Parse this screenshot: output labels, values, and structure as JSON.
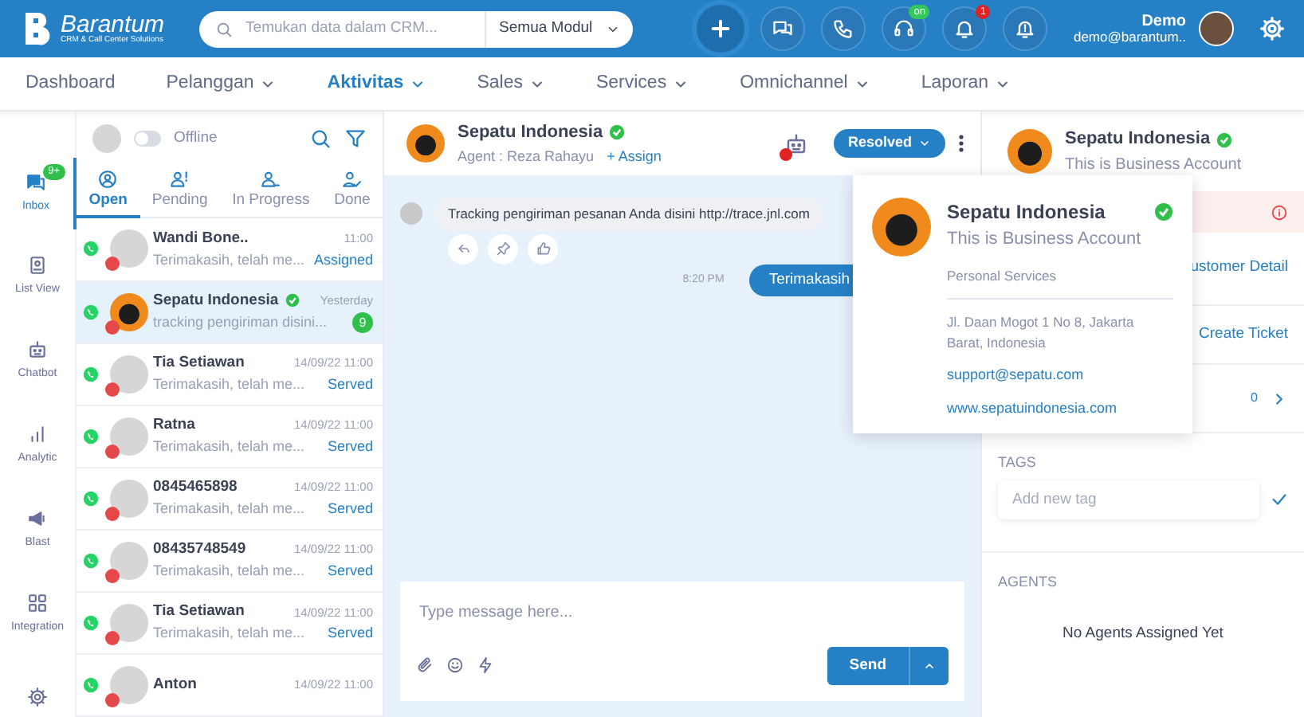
{
  "header": {
    "logo": {
      "name": "Barantum",
      "tagline": "CRM & Call Center Solutions"
    },
    "search": {
      "placeholder": "Temukan data dalam CRM...",
      "module": "Semua Modul"
    },
    "actions": [
      {
        "kind": "add"
      },
      {
        "kind": "chat"
      },
      {
        "kind": "phone"
      },
      {
        "kind": "headset",
        "badge": "on",
        "color": "#35c759"
      },
      {
        "kind": "bell",
        "badge": "1",
        "color": "#e02424"
      },
      {
        "kind": "alert"
      }
    ],
    "user": {
      "name": "Demo",
      "email": "demo@barantum.."
    }
  },
  "nav": [
    {
      "label": "Dashboard",
      "dropdown": false,
      "selected": false
    },
    {
      "label": "Pelanggan",
      "dropdown": true,
      "selected": false
    },
    {
      "label": "Aktivitas",
      "dropdown": true,
      "selected": true
    },
    {
      "label": "Sales",
      "dropdown": true,
      "selected": false
    },
    {
      "label": "Services",
      "dropdown": true,
      "selected": false
    },
    {
      "label": "Omnichannel",
      "dropdown": true,
      "selected": false
    },
    {
      "label": "Laporan",
      "dropdown": true,
      "selected": false
    }
  ],
  "sidebar": {
    "items": [
      {
        "kind": "inbox",
        "label": "Inbox",
        "badge": "9+",
        "selected": true
      },
      {
        "kind": "list",
        "label": "List View",
        "selected": false
      },
      {
        "kind": "bot",
        "label": "Chatbot",
        "selected": false
      },
      {
        "kind": "chart",
        "label": "Analytic",
        "selected": false
      },
      {
        "kind": "blast",
        "label": "Blast",
        "selected": false
      },
      {
        "kind": "grid",
        "label": "Integration",
        "selected": false
      },
      {
        "kind": "gear",
        "selected": false
      }
    ]
  },
  "conversations": {
    "status_toggle": {
      "label": "Offline",
      "on": false
    },
    "tabs": [
      {
        "kind": "open",
        "label": "Open",
        "selected": true
      },
      {
        "kind": "pending",
        "label": "Pending",
        "selected": false
      },
      {
        "kind": "progress",
        "label": "In Progress",
        "selected": false
      },
      {
        "kind": "done",
        "label": "Done",
        "selected": false
      }
    ],
    "items": [
      {
        "name": "Wandi Bone..",
        "time": "11:00",
        "preview": "Terimakasih, telah me...",
        "status": "Assigned",
        "photo": false,
        "verified": false,
        "online": false,
        "selected": false
      },
      {
        "name": "Sepatu Indonesia",
        "time": "Yesterday",
        "preview": "tracking pengiriman disini...",
        "unread": "9",
        "photo": true,
        "verified": true,
        "online": false,
        "selected": true
      },
      {
        "name": "Tia Setiawan",
        "time": "14/09/22 11:00",
        "preview": "Terimakasih, telah me...",
        "status": "Served",
        "photo": false,
        "verified": false,
        "online": false,
        "selected": false
      },
      {
        "name": "Ratna",
        "time": "14/09/22 11:00",
        "preview": "Terimakasih, telah me...",
        "status": "Served",
        "photo": false,
        "verified": false,
        "online": false,
        "selected": false
      },
      {
        "name": "0845465898",
        "time": "14/09/22 11:00",
        "preview": "Terimakasih, telah me...",
        "status": "Served",
        "photo": false,
        "verified": false,
        "online": false,
        "selected": false
      },
      {
        "name": "08435748549",
        "time": "14/09/22 11:00",
        "preview": "Terimakasih, telah me...",
        "status": "Served",
        "photo": false,
        "verified": false,
        "online": false,
        "selected": false
      },
      {
        "name": "Tia Setiawan",
        "time": "14/09/22 11:00",
        "preview": "Terimakasih, telah me...",
        "status": "Served",
        "photo": false,
        "verified": false,
        "online": false,
        "selected": false
      },
      {
        "name": "Anton",
        "time": "14/09/22 11:00",
        "photo": false,
        "verified": false,
        "online": false,
        "selected": false
      }
    ]
  },
  "chat": {
    "contact": {
      "name": "Sepatu Indonesia",
      "verified": true,
      "agent": "Agent : Reza Rahayu",
      "assign": "+ Assign"
    },
    "bot_on": false,
    "status": "Resolved",
    "messages": [
      {
        "kind": "incoming",
        "text": "Tracking pengiriman pesanan Anda disini http://trace.jnl.com"
      },
      {
        "kind": "outgoing",
        "text": "Terimakasih",
        "time": "8:20 PM"
      }
    ],
    "composer": {
      "placeholder": "Type message here...",
      "send": "Send"
    }
  },
  "profile_popup": {
    "name": "Sepatu Indonesia",
    "verified": true,
    "subtitle": "This is Business Account",
    "category": "Personal Services",
    "address": "Jl. Daan Mogot 1 No 8, Jakarta Barat, Indonesia",
    "email": "support@sepatu.com",
    "website": "www.sepatuindonesia.com"
  },
  "details": {
    "name": "Sepatu Indonesia",
    "verified": true,
    "subtitle": "This is Business Account",
    "customer_detail": "ustomer Detail",
    "create_ticket": "Create Ticket",
    "ticket_count": "0",
    "tags_label": "TAGS",
    "tag_placeholder": "Add new tag",
    "agents_label": "AGENTS",
    "agents_empty": "No Agents Assigned Yet"
  }
}
